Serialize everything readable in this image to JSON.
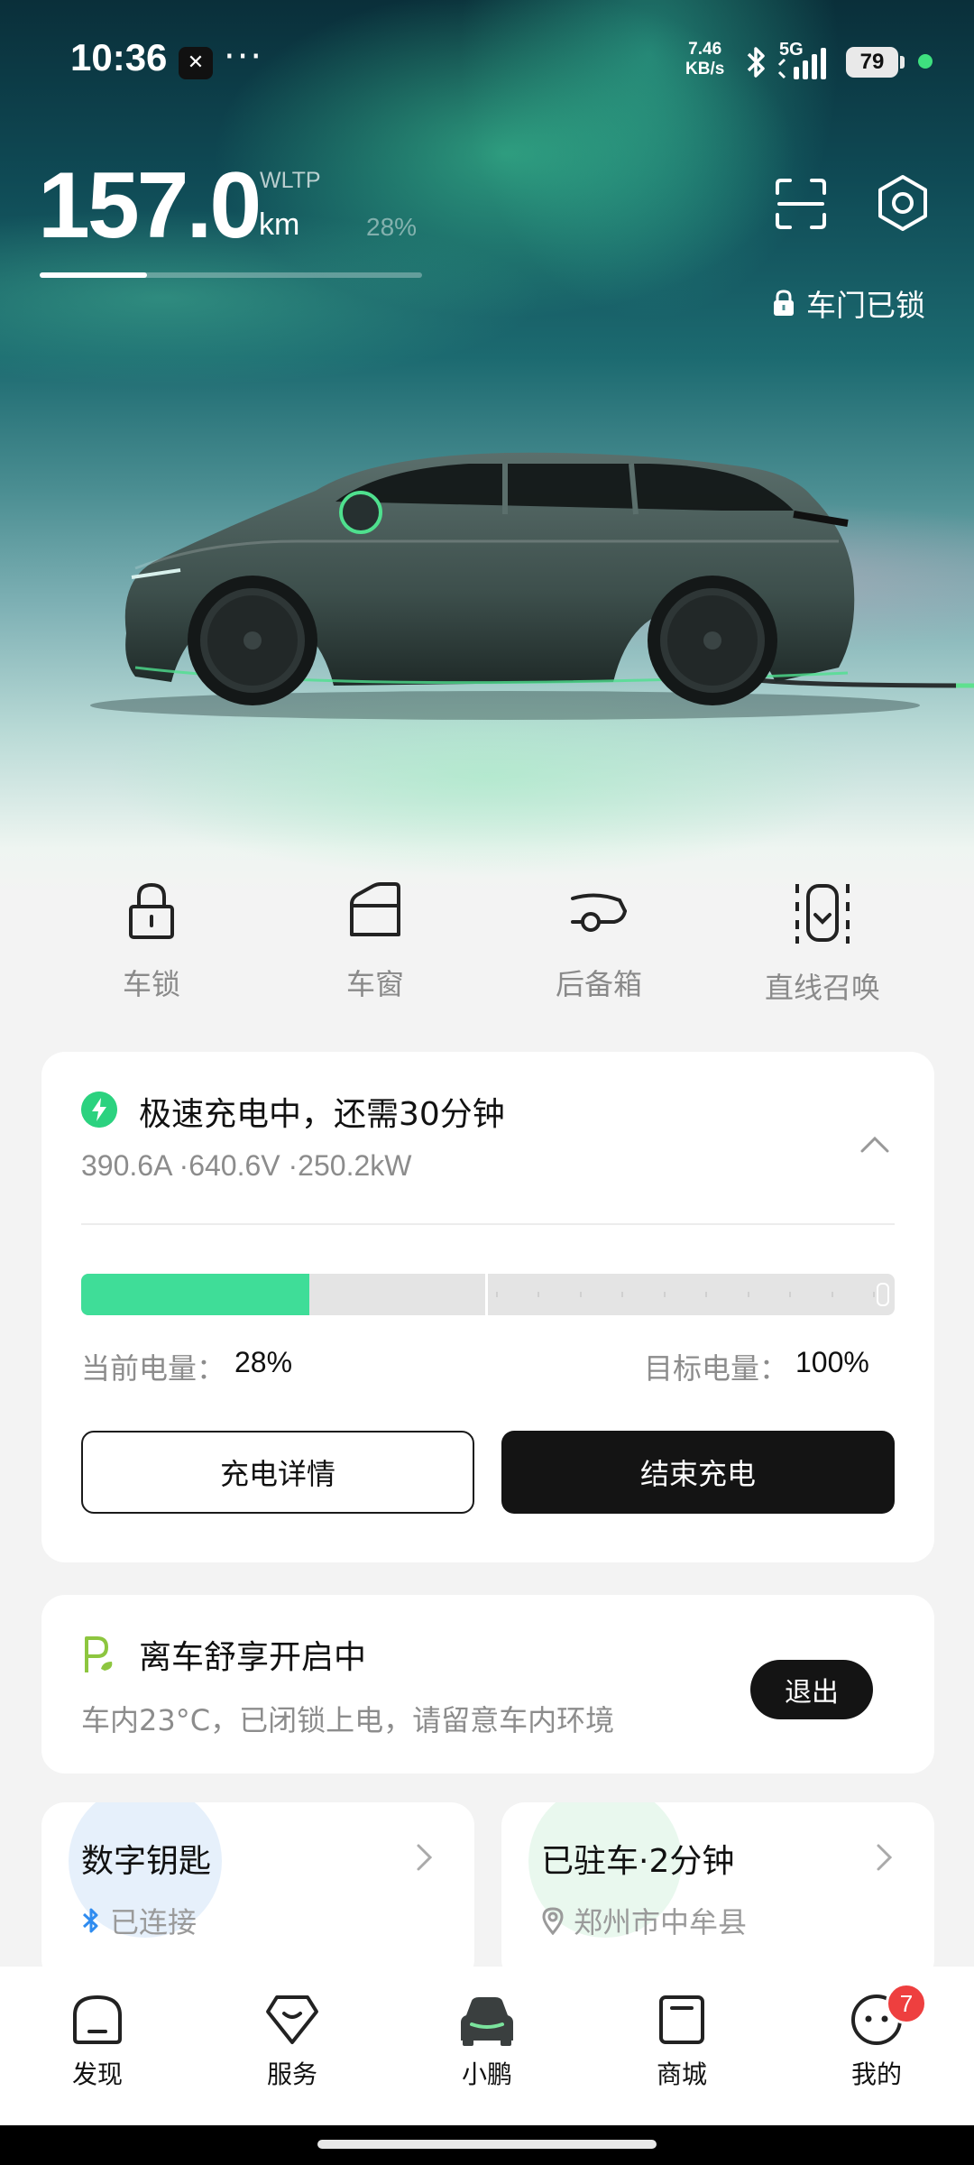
{
  "status_bar": {
    "time": "10:36",
    "app_badge": "✕",
    "more": "···",
    "net_speed_value": "7.46",
    "net_speed_unit": "KB/s",
    "network": "5G",
    "battery": "79"
  },
  "range": {
    "value": "157.0",
    "standard": "WLTP",
    "unit": "km",
    "battery_percent_label": "28%",
    "battery_fraction": 0.28
  },
  "header": {
    "scan_icon": "scan-icon",
    "settings_icon": "settings-hexagon-icon",
    "door_status": "车门已锁"
  },
  "quick_controls": [
    {
      "label": "车锁",
      "icon": "lock-icon"
    },
    {
      "label": "车窗",
      "icon": "window-icon"
    },
    {
      "label": "后备箱",
      "icon": "trunk-icon"
    },
    {
      "label": "直线召唤",
      "icon": "summon-icon"
    }
  ],
  "charging": {
    "title": "极速充电中，还需30分钟",
    "specs": "390.6A ·640.6V ·250.2kW",
    "current_label": "当前电量：",
    "current_value": "28%",
    "current_fraction": 0.28,
    "target_label": "目标电量：",
    "target_value": "100%",
    "details_button": "充电详情",
    "stop_button": "结束充电",
    "accent_color": "#3fdd98"
  },
  "comfort": {
    "title": "离车舒享开启中",
    "subtitle": "车内23°C，已闭锁上电，请留意车内环境",
    "exit_button": "退出"
  },
  "digital_key": {
    "title": "数字钥匙",
    "status": "已连接"
  },
  "parking": {
    "title": "已驻车·2分钟",
    "location": "郑州市中牟县"
  },
  "bottom_nav": [
    {
      "label": "发现",
      "icon": "discover-icon"
    },
    {
      "label": "服务",
      "icon": "service-icon"
    },
    {
      "label": "小鹏",
      "icon": "car-icon"
    },
    {
      "label": "商城",
      "icon": "mall-icon"
    },
    {
      "label": "我的",
      "icon": "profile-icon",
      "badge": "7"
    }
  ]
}
